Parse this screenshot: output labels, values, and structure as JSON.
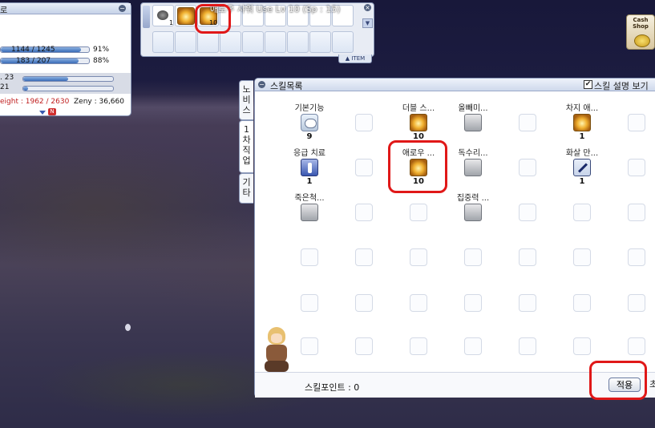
{
  "status": {
    "title": "로",
    "hp_text": "1144 / 1245",
    "hp_pct": "91%",
    "hp_fraction": 0.91,
    "sp_text": "183 / 207",
    "sp_pct": "88%",
    "sp_fraction": 0.88,
    "base_exp": ". 23",
    "base_exp_fraction": 0.5,
    "job_exp": "21",
    "job_exp_fraction": 0.05,
    "weight_text": "eight : 1962 / 2630",
    "zeny_text": "Zeny : 36,660",
    "new_badge": "N"
  },
  "hotkey": {
    "slot_qty": "1",
    "second_slot_qty": "10",
    "tooltip": "애로우 샤워 Use Lv 10 (Sp : 15)",
    "item_tab": "▲ ITEM",
    "scroll_icon": "scroll-down-icon"
  },
  "cash_shop": {
    "label": "Cash Shop"
  },
  "skill_window": {
    "title": "스킬목록",
    "show_desc_label": "스킬 설명 보기",
    "show_desc_checked": "✔",
    "tabs": [
      "노비스",
      "1차직업",
      "기타"
    ],
    "skills": [
      {
        "name": "기본기능",
        "level": "9",
        "icon": "basic"
      },
      {
        "name": "더블 스...",
        "level": "10",
        "icon": "gold"
      },
      {
        "name": "올빼미...",
        "level": "",
        "icon": "gray"
      },
      {
        "name": "차지 애...",
        "level": "1",
        "icon": "gold"
      },
      {
        "name": "응급 치료",
        "level": "1",
        "icon": "heal"
      },
      {
        "name": "애로우 ...",
        "level": "10",
        "icon": "gold"
      },
      {
        "name": "독수리...",
        "level": "",
        "icon": "gray"
      },
      {
        "name": "화살 만...",
        "level": "1",
        "icon": "arrow"
      },
      {
        "name": "죽은척...",
        "level": "",
        "icon": "gray"
      },
      {
        "name": "집중력 ...",
        "level": "",
        "icon": "gray"
      }
    ],
    "skill_points_label": "스킬포인트 : 0",
    "apply_label": "적용",
    "next_label": "초"
  }
}
